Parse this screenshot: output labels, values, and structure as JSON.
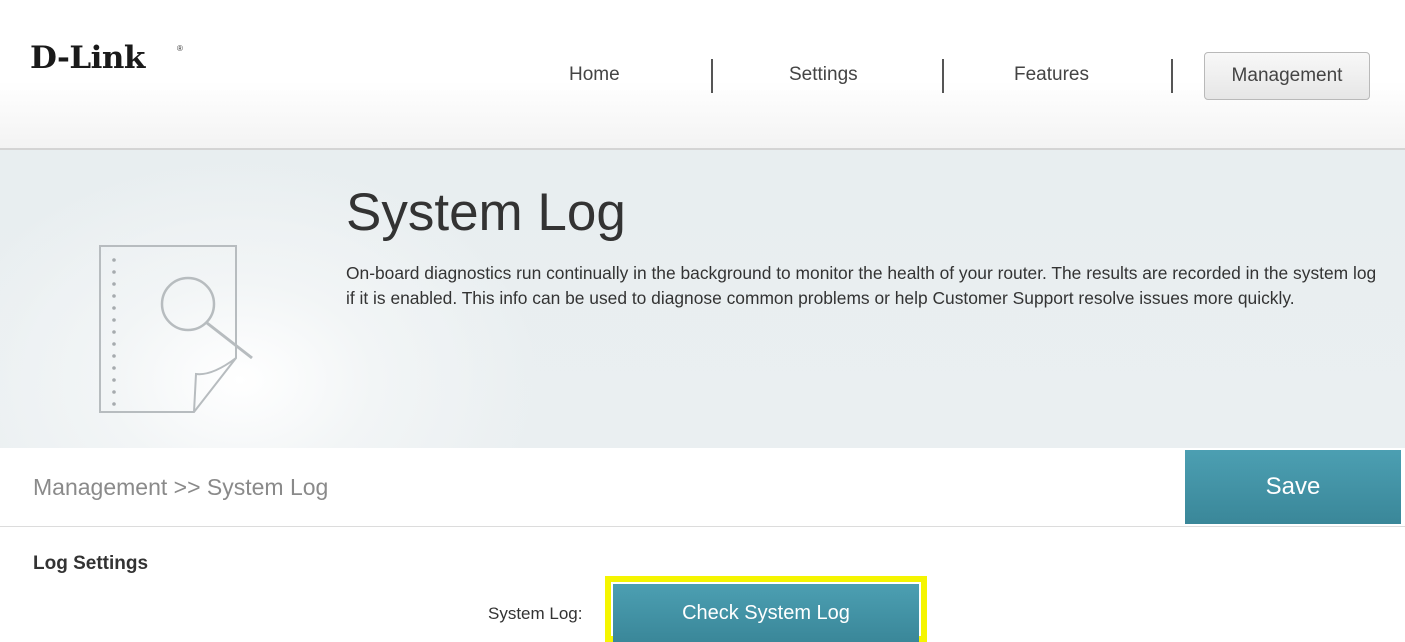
{
  "brand": {
    "logo_text": "D-Link",
    "registered_mark": "®"
  },
  "nav": {
    "items": [
      {
        "label": "Home"
      },
      {
        "label": "Settings"
      },
      {
        "label": "Features"
      },
      {
        "label": "Management",
        "active": true
      }
    ]
  },
  "page": {
    "title": "System Log",
    "description": "On-board diagnostics run continually in the background to monitor the health of your router. The results are recorded in the system log if it is enabled. This info can be used to diagnose common problems or help Customer Support resolve issues more quickly.",
    "icon": "document-search-icon"
  },
  "breadcrumb": "Management >> System Log",
  "toolbar": {
    "save_label": "Save"
  },
  "log_settings": {
    "section_title": "Log Settings",
    "system_log_label": "System Log:",
    "check_button_label": "Check System Log"
  },
  "colors": {
    "accent": "#3f8fa2",
    "highlight": "#f5f500",
    "banner_bg": "#e9eef0"
  }
}
